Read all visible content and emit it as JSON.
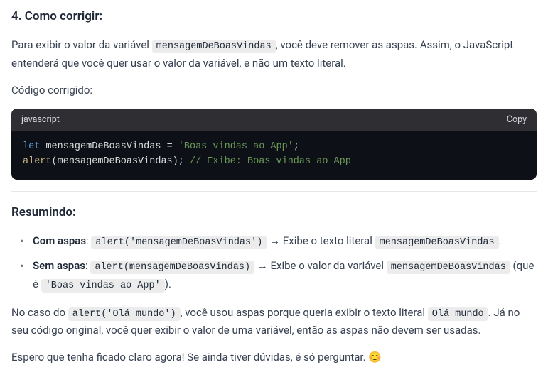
{
  "section1": {
    "heading": "4. Como corrigir:",
    "p1_a": "Para exibir o valor da variável ",
    "p1_code": "mensagemDeBoasVindas",
    "p1_b": ", você deve remover as aspas. Assim, o JavaScript entenderá que você quer usar o valor da variável, e não um texto literal.",
    "p2": "Código corrigido:"
  },
  "codeblock": {
    "lang": "javascript",
    "copy": "Copy",
    "line1": {
      "kw": "let",
      "id": "mensagemDeBoasVindas",
      "op": "=",
      "str": "'Boas vindas ao App'",
      "semi": ";"
    },
    "line2": {
      "fn": "alert",
      "lp": "(",
      "arg": "mensagemDeBoasVindas",
      "rp": ")",
      "semi": ";",
      "comment": "// Exibe: Boas vindas ao App"
    }
  },
  "section2": {
    "heading": "Resumindo:",
    "bullet1": {
      "label": "Com aspas",
      "code1": "alert('mensagemDeBoasVindas')",
      "mid": " → Exibe o texto literal ",
      "code2": "mensagemDeBoasVindas",
      "dot": "."
    },
    "bullet2": {
      "label": "Sem aspas",
      "code1": "alert(mensagemDeBoasVindas)",
      "mid": " → Exibe o valor da variável ",
      "code2": "mensagemDeBoasVindas",
      "tail_a": " (que é ",
      "code3": "'Boas vindas ao App'",
      "tail_b": ")."
    }
  },
  "closing": {
    "p1_a": "No caso do ",
    "p1_code1": "alert('Olá mundo')",
    "p1_b": ", você usou aspas porque queria exibir o texto literal ",
    "p1_code2": "Olá mundo",
    "p1_c": ". Já no seu código original, você quer exibir o valor de uma variável, então as aspas não devem ser usadas.",
    "p2": "Espero que tenha ficado claro agora! Se ainda tiver dúvidas, é só perguntar. ",
    "emoji": "😊"
  }
}
